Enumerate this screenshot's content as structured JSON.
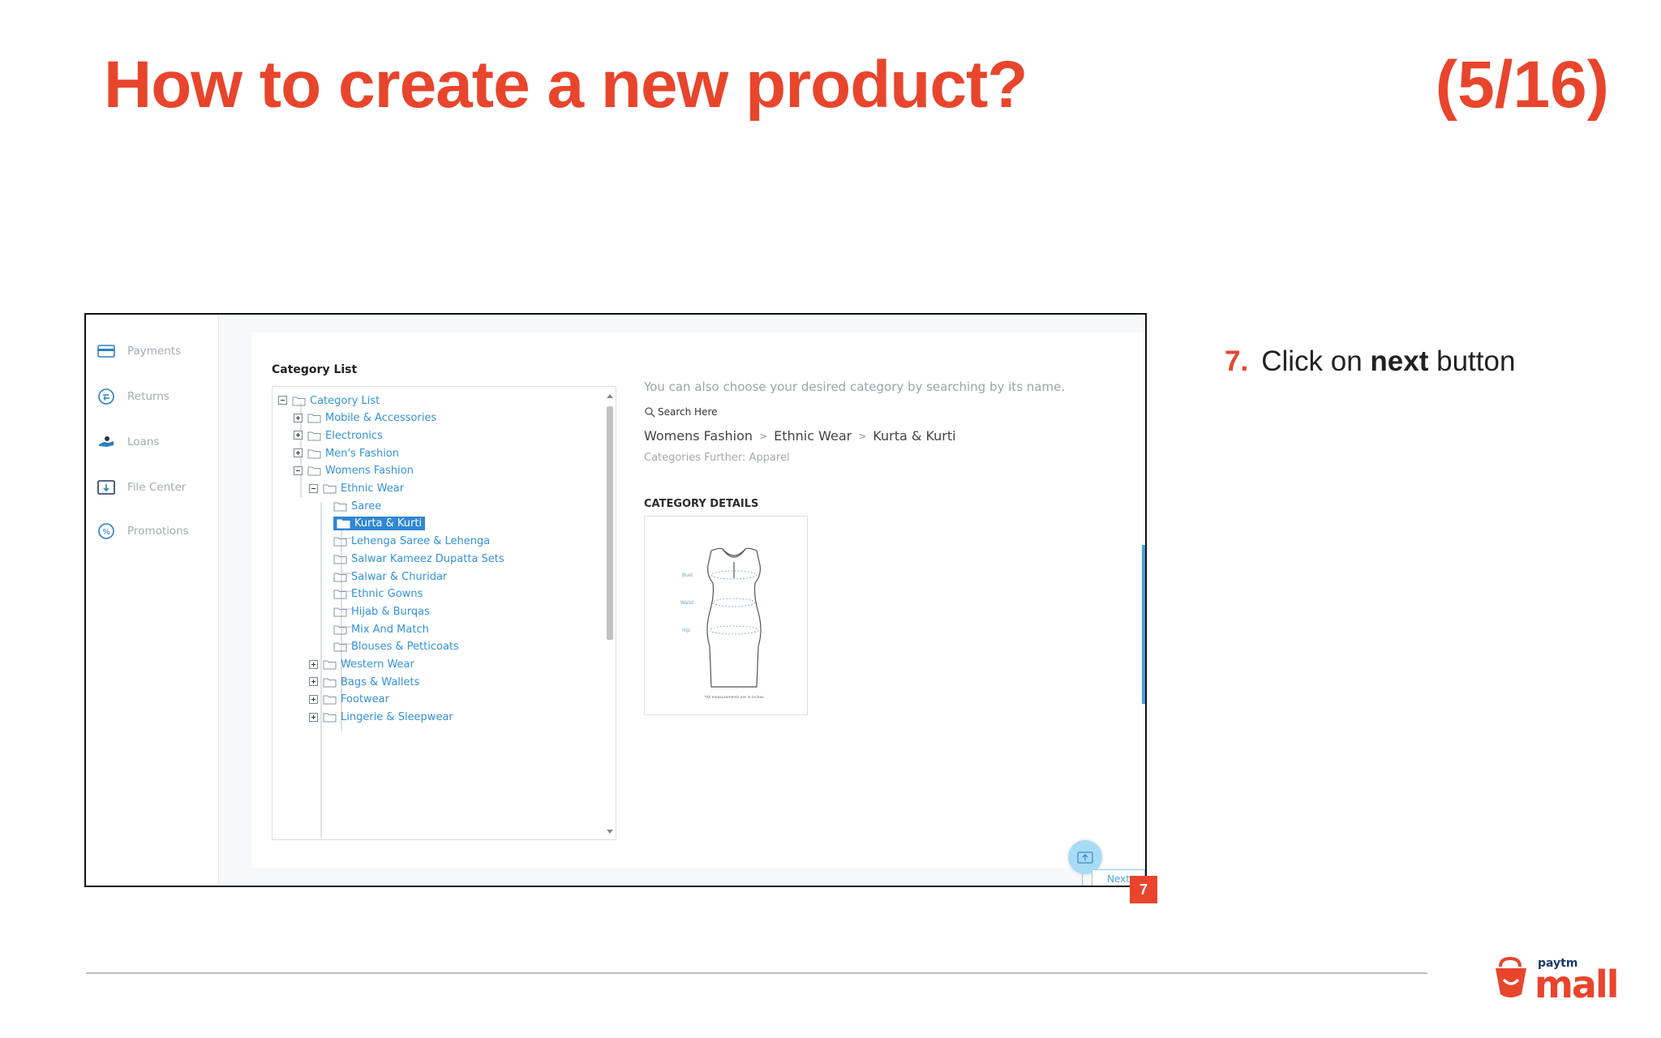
{
  "slide": {
    "title": "How to create a new product?",
    "counter": "(5/16)"
  },
  "sidebar": {
    "items": [
      {
        "label": "Payments",
        "icon": "credit-card-icon"
      },
      {
        "label": "Returns",
        "icon": "return-icon"
      },
      {
        "label": "Loans",
        "icon": "loan-icon"
      },
      {
        "label": "File Center",
        "icon": "file-upload-icon"
      },
      {
        "label": "Promotions",
        "icon": "percent-badge-icon"
      }
    ]
  },
  "category_list": {
    "heading": "Category List",
    "tree": [
      {
        "label": "Category List",
        "expander": "minus"
      },
      {
        "label": "Mobile & Accessories",
        "expander": "plus"
      },
      {
        "label": "Electronics",
        "expander": "plus"
      },
      {
        "label": "Men's Fashion",
        "expander": "plus"
      },
      {
        "label": "Womens Fashion",
        "expander": "minus"
      },
      {
        "label": "Ethnic Wear",
        "expander": "minus"
      },
      {
        "label": "Saree",
        "expander": "none"
      },
      {
        "label": "Kurta & Kurti",
        "expander": "none",
        "selected": true
      },
      {
        "label": "Lehenga Saree & Lehenga",
        "expander": "none"
      },
      {
        "label": "Salwar Kameez Dupatta Sets",
        "expander": "none"
      },
      {
        "label": "Salwar & Churidar",
        "expander": "none"
      },
      {
        "label": "Ethnic Gowns",
        "expander": "none"
      },
      {
        "label": "Hijab & Burqas",
        "expander": "none"
      },
      {
        "label": "Mix And Match",
        "expander": "none"
      },
      {
        "label": "Blouses & Petticoats",
        "expander": "none"
      },
      {
        "label": "Western Wear",
        "expander": "plus"
      },
      {
        "label": "Bags & Wallets",
        "expander": "plus"
      },
      {
        "label": "Footwear",
        "expander": "plus"
      },
      {
        "label": "Lingerie & Sleepwear",
        "expander": "plus"
      }
    ]
  },
  "search_panel": {
    "hint": "You can also choose your desired category by searching by its name.",
    "search_placeholder": "Search Here",
    "breadcrumb": [
      "Womens Fashion",
      "Ethnic Wear",
      "Kurta & Kurti"
    ],
    "breadcrumb_separator": ">",
    "further": "Categories Further: Apparel"
  },
  "category_details": {
    "heading": "CATEGORY DETAILS",
    "diagram_labels": {
      "bust": "Bust",
      "waist": "Waist",
      "hip": "Hip",
      "note": "*All measurements are in inches"
    }
  },
  "actions": {
    "next_label": "Next"
  },
  "step": {
    "badge": "7",
    "number": "7.",
    "text_before": "Click on",
    "text_bold": "next",
    "text_after": "button"
  },
  "colors": {
    "accent": "#e8452c",
    "link_blue": "#3592d8",
    "selected_blue": "#2f86d4"
  },
  "logo": {
    "small_text": "paytm",
    "big_text": "mall"
  }
}
